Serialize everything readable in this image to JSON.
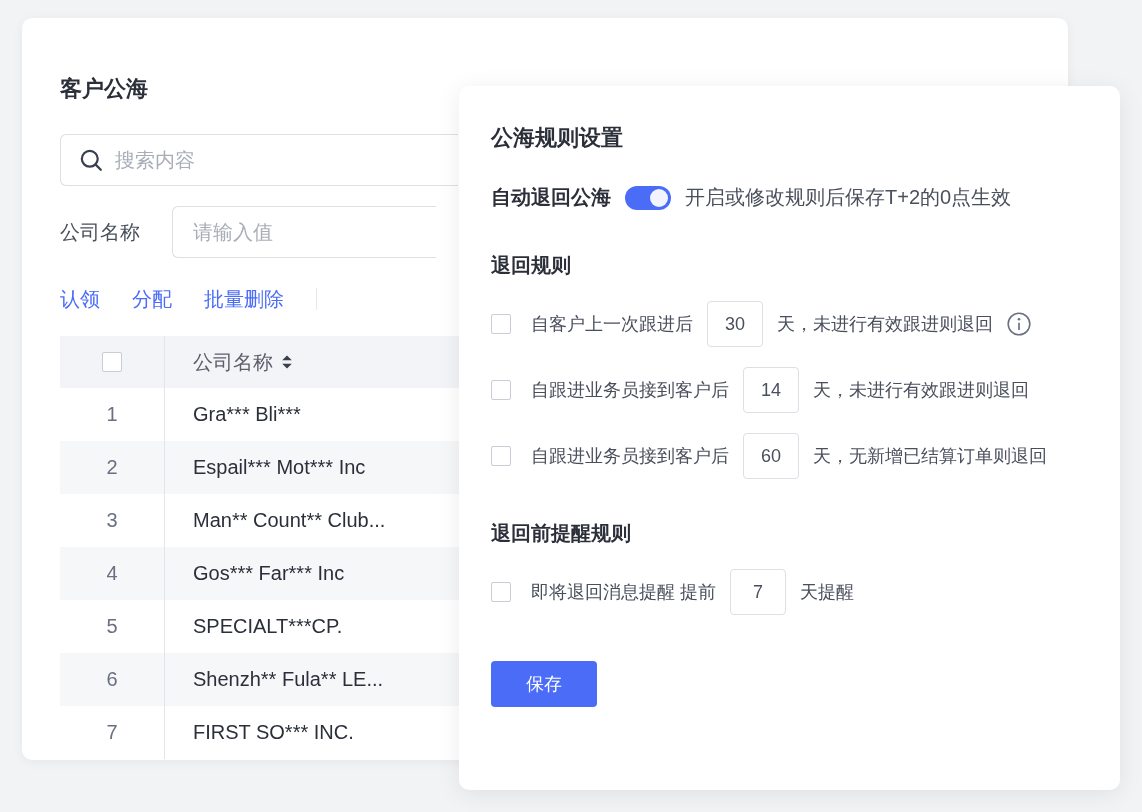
{
  "page": {
    "title": "客户公海"
  },
  "search": {
    "placeholder": "搜索内容"
  },
  "filter": {
    "label": "公司名称",
    "placeholder": "请输入值"
  },
  "actions": [
    "认领",
    "分配",
    "批量删除"
  ],
  "table": {
    "header_checked": false,
    "columns": [
      "公司名称"
    ],
    "rows": [
      {
        "index": "1",
        "company": "Gra*** Bli***"
      },
      {
        "index": "2",
        "company": "Espail*** Mot*** Inc"
      },
      {
        "index": "3",
        "company": "Man** Count** Club..."
      },
      {
        "index": "4",
        "company": "Gos*** Far*** Inc"
      },
      {
        "index": "5",
        "company": "SPECIALT***CP."
      },
      {
        "index": "6",
        "company": "Shenzh** Fula** LE..."
      },
      {
        "index": "7",
        "company": "FIRST SO*** INC."
      }
    ]
  },
  "panel": {
    "title": "公海规则设置",
    "auto_return": {
      "label": "自动退回公海",
      "on": true,
      "hint": "开启或修改规则后保存T+2的0点生效"
    },
    "sections": [
      {
        "title": "退回规则",
        "rules": [
          {
            "kind": "info",
            "checked": false,
            "before": "自客户上一次跟进后",
            "value": "30",
            "after": "天，未进行有效跟进则退回"
          },
          {
            "kind": "plain",
            "checked": false,
            "before": "自跟进业务员接到客户后",
            "value": "14",
            "after": "天，未进行有效跟进则退回"
          },
          {
            "kind": "plain",
            "checked": false,
            "before": "自跟进业务员接到客户后",
            "value": "60",
            "after": "天，无新增已结算订单则退回"
          }
        ]
      },
      {
        "title": "退回前提醒规则",
        "rules": [
          {
            "kind": "plain",
            "checked": false,
            "before": "即将退回消息提醒 提前",
            "value": "7",
            "after": "天提醒"
          }
        ]
      }
    ],
    "save": "保存"
  }
}
